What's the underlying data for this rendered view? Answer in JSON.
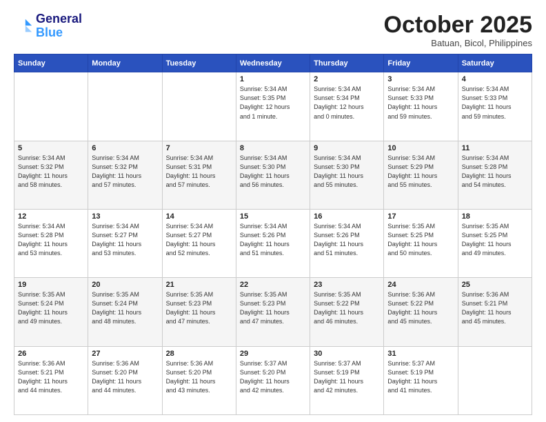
{
  "header": {
    "logo_line1": "General",
    "logo_line2": "Blue",
    "month": "October 2025",
    "location": "Batuan, Bicol, Philippines"
  },
  "weekdays": [
    "Sunday",
    "Monday",
    "Tuesday",
    "Wednesday",
    "Thursday",
    "Friday",
    "Saturday"
  ],
  "weeks": [
    [
      {
        "day": "",
        "info": ""
      },
      {
        "day": "",
        "info": ""
      },
      {
        "day": "",
        "info": ""
      },
      {
        "day": "1",
        "info": "Sunrise: 5:34 AM\nSunset: 5:35 PM\nDaylight: 12 hours\nand 1 minute."
      },
      {
        "day": "2",
        "info": "Sunrise: 5:34 AM\nSunset: 5:34 PM\nDaylight: 12 hours\nand 0 minutes."
      },
      {
        "day": "3",
        "info": "Sunrise: 5:34 AM\nSunset: 5:33 PM\nDaylight: 11 hours\nand 59 minutes."
      },
      {
        "day": "4",
        "info": "Sunrise: 5:34 AM\nSunset: 5:33 PM\nDaylight: 11 hours\nand 59 minutes."
      }
    ],
    [
      {
        "day": "5",
        "info": "Sunrise: 5:34 AM\nSunset: 5:32 PM\nDaylight: 11 hours\nand 58 minutes."
      },
      {
        "day": "6",
        "info": "Sunrise: 5:34 AM\nSunset: 5:32 PM\nDaylight: 11 hours\nand 57 minutes."
      },
      {
        "day": "7",
        "info": "Sunrise: 5:34 AM\nSunset: 5:31 PM\nDaylight: 11 hours\nand 57 minutes."
      },
      {
        "day": "8",
        "info": "Sunrise: 5:34 AM\nSunset: 5:30 PM\nDaylight: 11 hours\nand 56 minutes."
      },
      {
        "day": "9",
        "info": "Sunrise: 5:34 AM\nSunset: 5:30 PM\nDaylight: 11 hours\nand 55 minutes."
      },
      {
        "day": "10",
        "info": "Sunrise: 5:34 AM\nSunset: 5:29 PM\nDaylight: 11 hours\nand 55 minutes."
      },
      {
        "day": "11",
        "info": "Sunrise: 5:34 AM\nSunset: 5:28 PM\nDaylight: 11 hours\nand 54 minutes."
      }
    ],
    [
      {
        "day": "12",
        "info": "Sunrise: 5:34 AM\nSunset: 5:28 PM\nDaylight: 11 hours\nand 53 minutes."
      },
      {
        "day": "13",
        "info": "Sunrise: 5:34 AM\nSunset: 5:27 PM\nDaylight: 11 hours\nand 53 minutes."
      },
      {
        "day": "14",
        "info": "Sunrise: 5:34 AM\nSunset: 5:27 PM\nDaylight: 11 hours\nand 52 minutes."
      },
      {
        "day": "15",
        "info": "Sunrise: 5:34 AM\nSunset: 5:26 PM\nDaylight: 11 hours\nand 51 minutes."
      },
      {
        "day": "16",
        "info": "Sunrise: 5:34 AM\nSunset: 5:26 PM\nDaylight: 11 hours\nand 51 minutes."
      },
      {
        "day": "17",
        "info": "Sunrise: 5:35 AM\nSunset: 5:25 PM\nDaylight: 11 hours\nand 50 minutes."
      },
      {
        "day": "18",
        "info": "Sunrise: 5:35 AM\nSunset: 5:25 PM\nDaylight: 11 hours\nand 49 minutes."
      }
    ],
    [
      {
        "day": "19",
        "info": "Sunrise: 5:35 AM\nSunset: 5:24 PM\nDaylight: 11 hours\nand 49 minutes."
      },
      {
        "day": "20",
        "info": "Sunrise: 5:35 AM\nSunset: 5:24 PM\nDaylight: 11 hours\nand 48 minutes."
      },
      {
        "day": "21",
        "info": "Sunrise: 5:35 AM\nSunset: 5:23 PM\nDaylight: 11 hours\nand 47 minutes."
      },
      {
        "day": "22",
        "info": "Sunrise: 5:35 AM\nSunset: 5:23 PM\nDaylight: 11 hours\nand 47 minutes."
      },
      {
        "day": "23",
        "info": "Sunrise: 5:35 AM\nSunset: 5:22 PM\nDaylight: 11 hours\nand 46 minutes."
      },
      {
        "day": "24",
        "info": "Sunrise: 5:36 AM\nSunset: 5:22 PM\nDaylight: 11 hours\nand 45 minutes."
      },
      {
        "day": "25",
        "info": "Sunrise: 5:36 AM\nSunset: 5:21 PM\nDaylight: 11 hours\nand 45 minutes."
      }
    ],
    [
      {
        "day": "26",
        "info": "Sunrise: 5:36 AM\nSunset: 5:21 PM\nDaylight: 11 hours\nand 44 minutes."
      },
      {
        "day": "27",
        "info": "Sunrise: 5:36 AM\nSunset: 5:20 PM\nDaylight: 11 hours\nand 44 minutes."
      },
      {
        "day": "28",
        "info": "Sunrise: 5:36 AM\nSunset: 5:20 PM\nDaylight: 11 hours\nand 43 minutes."
      },
      {
        "day": "29",
        "info": "Sunrise: 5:37 AM\nSunset: 5:20 PM\nDaylight: 11 hours\nand 42 minutes."
      },
      {
        "day": "30",
        "info": "Sunrise: 5:37 AM\nSunset: 5:19 PM\nDaylight: 11 hours\nand 42 minutes."
      },
      {
        "day": "31",
        "info": "Sunrise: 5:37 AM\nSunset: 5:19 PM\nDaylight: 11 hours\nand 41 minutes."
      },
      {
        "day": "",
        "info": ""
      }
    ]
  ]
}
